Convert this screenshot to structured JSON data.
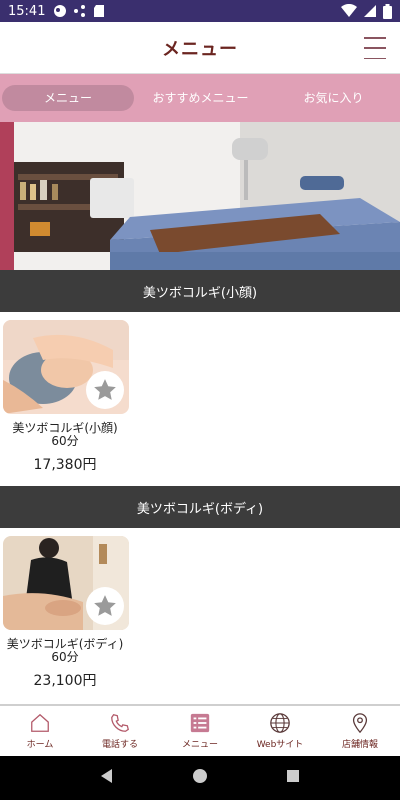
{
  "status_bar": {
    "time": "15:41"
  },
  "header": {
    "title": "メニュー"
  },
  "tabs": [
    {
      "label": "メニュー",
      "active": true
    },
    {
      "label": "おすすめメニュー",
      "active": false
    },
    {
      "label": "お気に入り",
      "active": false
    }
  ],
  "sections": [
    {
      "title": "美ツボコルギ(小顔)",
      "items": [
        {
          "name": "美ツボコルギ(小顔)",
          "duration": "60分",
          "price": "17,380円"
        }
      ]
    },
    {
      "title": "美ツボコルギ(ボディ)",
      "items": [
        {
          "name": "美ツボコルギ(ボディ)",
          "duration": "60分",
          "price": "23,100円"
        }
      ]
    }
  ],
  "bottom_nav": [
    {
      "label": "ホーム",
      "icon": "home-icon"
    },
    {
      "label": "電話する",
      "icon": "phone-icon"
    },
    {
      "label": "メニュー",
      "icon": "list-icon"
    },
    {
      "label": "Webサイト",
      "icon": "globe-icon"
    },
    {
      "label": "店舗情報",
      "icon": "location-pin-icon"
    }
  ],
  "colors": {
    "status_bar": "#3a2f6e",
    "accent_pink": "#e0a0b6",
    "brand_brown": "#6b2520",
    "section_dark": "#3c3c3c"
  }
}
